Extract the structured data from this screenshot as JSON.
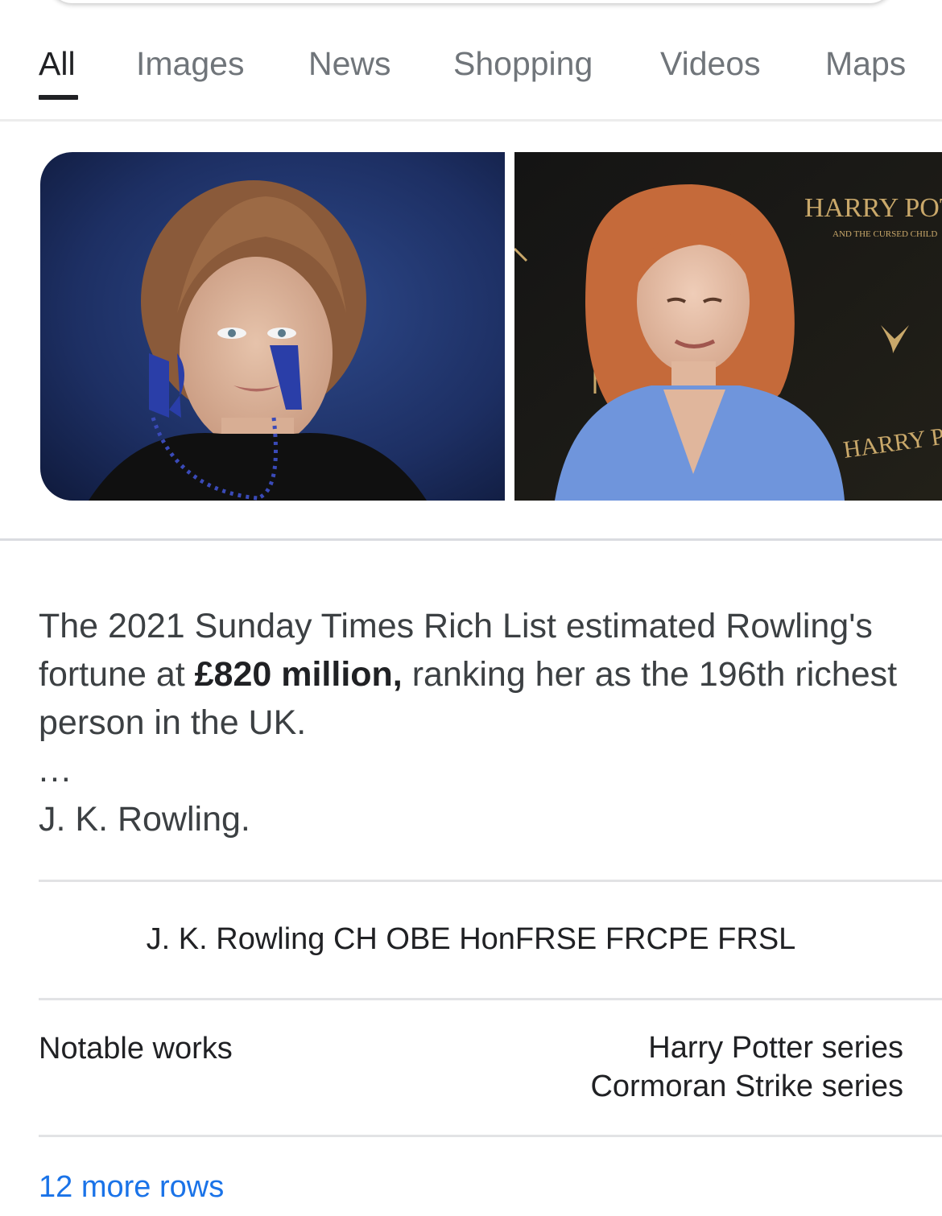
{
  "tabs": [
    {
      "label": "All",
      "active": true
    },
    {
      "label": "Images",
      "active": false
    },
    {
      "label": "News",
      "active": false
    },
    {
      "label": "Shopping",
      "active": false
    },
    {
      "label": "Videos",
      "active": false
    },
    {
      "label": "Maps",
      "active": false
    }
  ],
  "images": {
    "photo_2_backdrop_text": [
      "HARRY POTTE",
      "HARRY PO",
      "AND THE CURSED CHILD"
    ]
  },
  "snippet": {
    "text_before": "The 2021 Sunday Times Rich List estimated Rowling's fortune at ",
    "bold": "£820 million,",
    "text_after": " ranking her as the 196th richest person in the UK.",
    "ellipsis": "...",
    "source": "J. K. Rowling."
  },
  "infobox": {
    "title": "J. K. Rowling CH OBE HonFRSE FRCPE FRSL",
    "rows": [
      {
        "label": "Notable works",
        "values": [
          "Harry Potter series",
          "Cormoran Strike series"
        ]
      }
    ],
    "more_rows_label": "12 more rows"
  },
  "colors": {
    "link": "#1a73e8",
    "text": "#202124",
    "tab_inactive": "#70757a",
    "divider": "#dadce0"
  }
}
